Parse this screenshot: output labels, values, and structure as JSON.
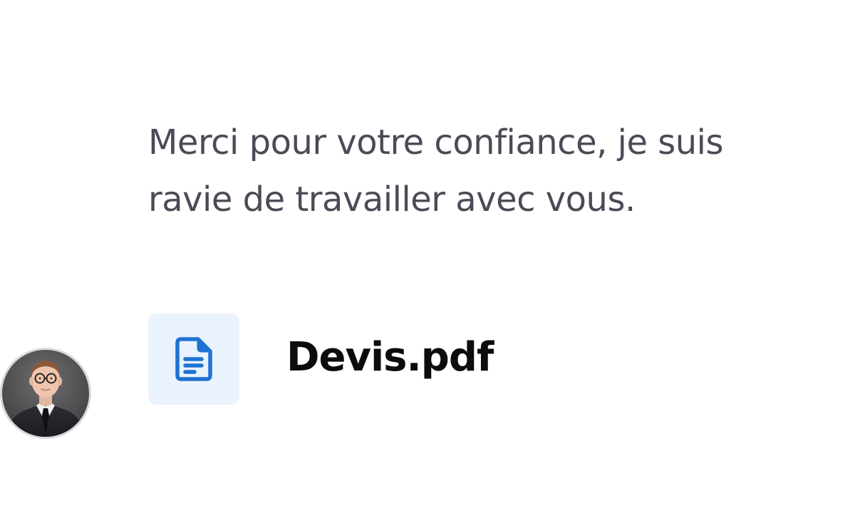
{
  "message": {
    "lines": [
      "Merci pour votre confiance, je suis",
      "ravie de travailler avec vous."
    ]
  },
  "attachment": {
    "file_name": "Devis.pdf",
    "icon": "document-icon",
    "icon_color": "#1e73d2",
    "tile_color": "#eaf2fd"
  },
  "sender": {
    "avatar": "avatar-photo"
  },
  "colors": {
    "message_text": "#4b4b57",
    "file_name_text": "#0c0c0c",
    "background": "#ffffff"
  }
}
